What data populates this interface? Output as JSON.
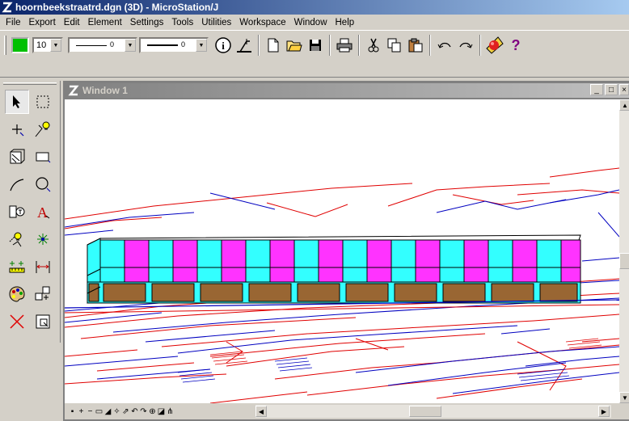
{
  "app": {
    "title": "hoornbeekstraatrd.dgn (3D) - MicroStation/J",
    "icon": "microstation-logo-icon"
  },
  "menu": [
    "File",
    "Export",
    "Edit",
    "Element",
    "Settings",
    "Tools",
    "Utilities",
    "Workspace",
    "Window",
    "Help"
  ],
  "attributes": {
    "active_color": "#00c000",
    "level": "10",
    "line_style": "0",
    "line_weight": "0"
  },
  "view": {
    "title": "Window 1"
  },
  "colors": {
    "model_cyan": "#33ffff",
    "model_magenta": "#ff33ff",
    "model_brown": "#996633",
    "lines_red": "#e00000",
    "lines_blue": "#0000c0"
  }
}
